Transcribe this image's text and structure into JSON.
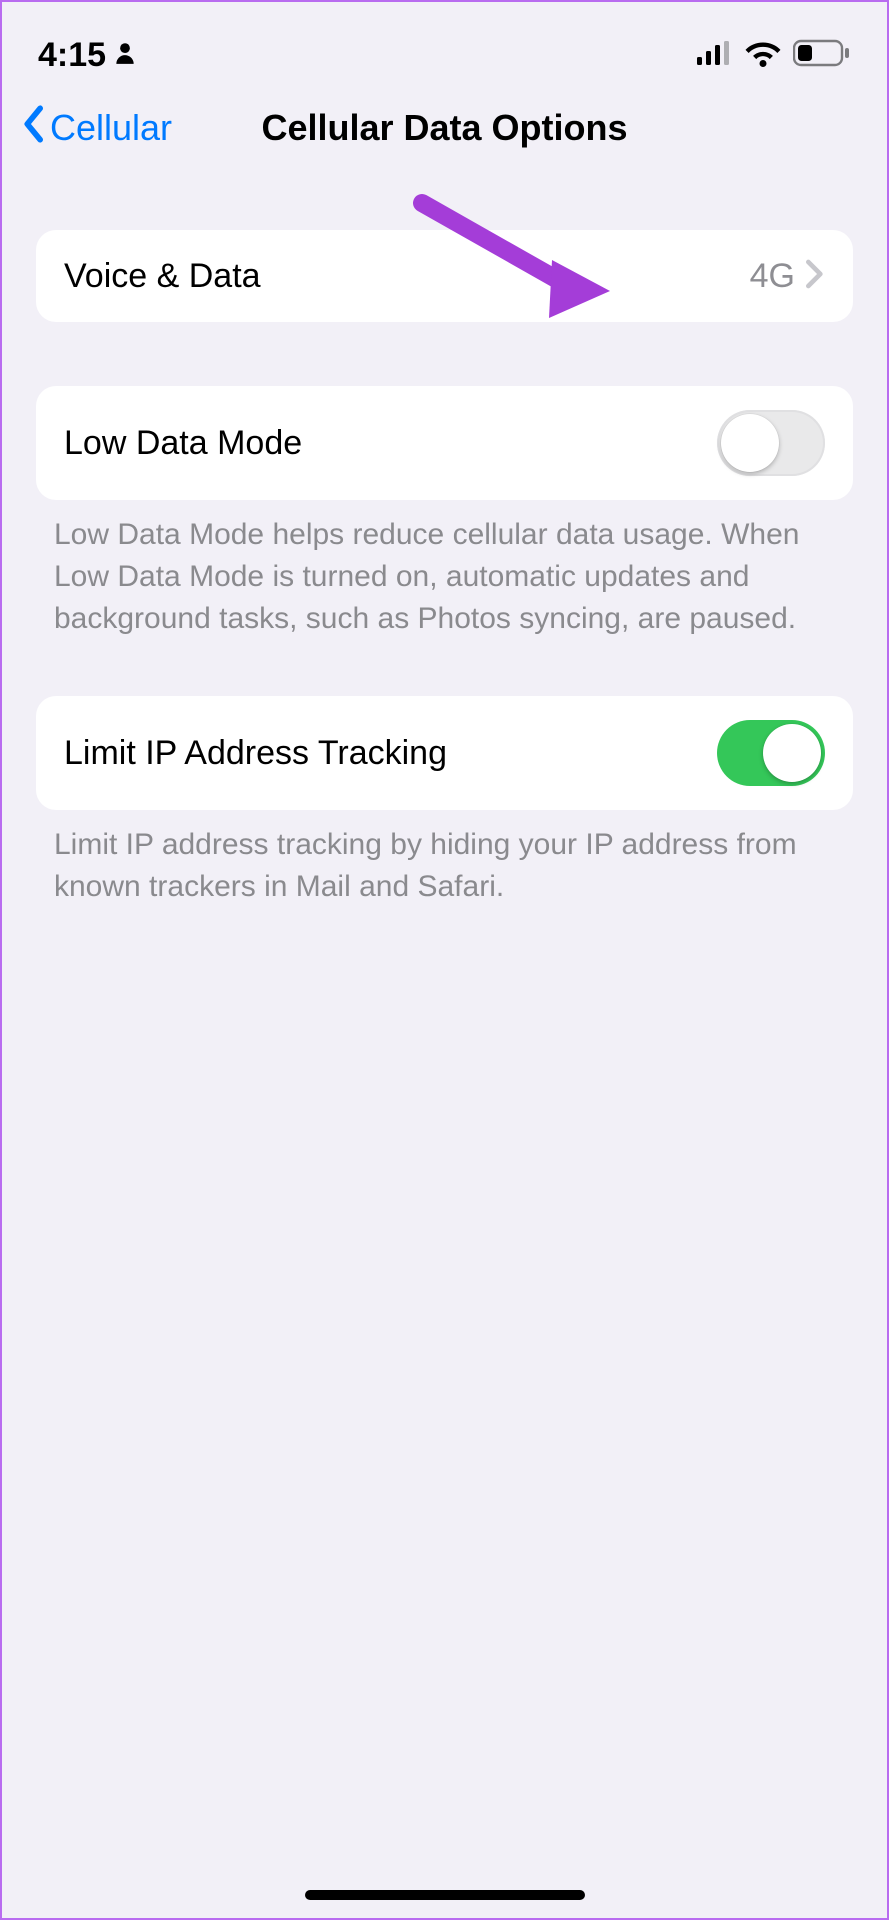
{
  "status": {
    "time": "4:15"
  },
  "nav": {
    "back_label": "Cellular",
    "title": "Cellular Data Options"
  },
  "rows": {
    "voice_data": {
      "label": "Voice & Data",
      "value": "4G"
    },
    "low_data": {
      "label": "Low Data Mode",
      "on": false,
      "footer": "Low Data Mode helps reduce cellular data usage. When Low Data Mode is turned on, automatic updates and background tasks, such as Photos syncing, are paused."
    },
    "limit_ip": {
      "label": "Limit IP Address Tracking",
      "on": true,
      "footer": "Limit IP address tracking by hiding your IP address from known trackers in Mail and Safari."
    }
  },
  "colors": {
    "accent_blue": "#007aff",
    "toggle_green": "#34c759",
    "annotation_purple": "#a43dd8"
  }
}
